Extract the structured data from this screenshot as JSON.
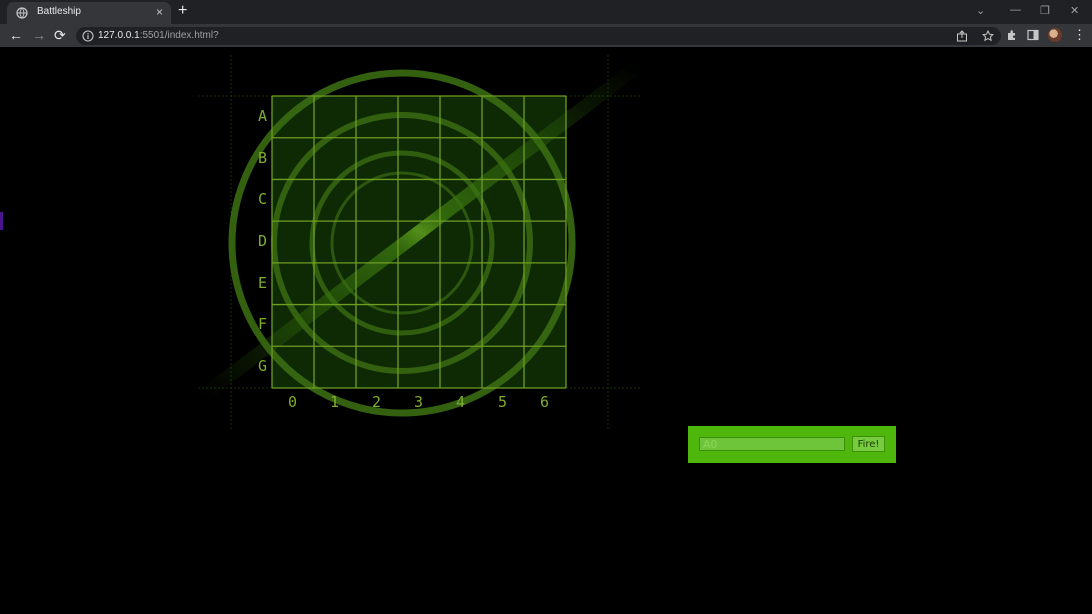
{
  "browser": {
    "tab_title": "Battleship",
    "tab_close": "×",
    "new_tab": "+",
    "url_host": "127.0.0.1",
    "url_rest": ":5501/index.html?",
    "controls": {
      "back": "←",
      "forward": "→",
      "reload": "⟳",
      "minimize": "—",
      "restore": "❐",
      "close": "✕",
      "dropdown": "⌄",
      "menu": "⋮"
    },
    "icons": [
      "globe-icon",
      "share-icon",
      "star-icon",
      "extensions-icon",
      "sidepanel-icon",
      "profile-avatar"
    ]
  },
  "game": {
    "rows": [
      "A",
      "B",
      "C",
      "D",
      "E",
      "F",
      "G"
    ],
    "cols": [
      "0",
      "1",
      "2",
      "3",
      "4",
      "5",
      "6"
    ],
    "colors": {
      "grid": "#6f9d23",
      "radar": "#3a6b12",
      "fill": "#0e2a04",
      "label": "#7fae2d"
    }
  },
  "fire_panel": {
    "input_placeholder": "A0",
    "input_value": "",
    "fire_label": "Fire!",
    "colors": {
      "panel": "#4fb60c",
      "input": "#6ec53a",
      "button": "#77cb3f"
    }
  }
}
